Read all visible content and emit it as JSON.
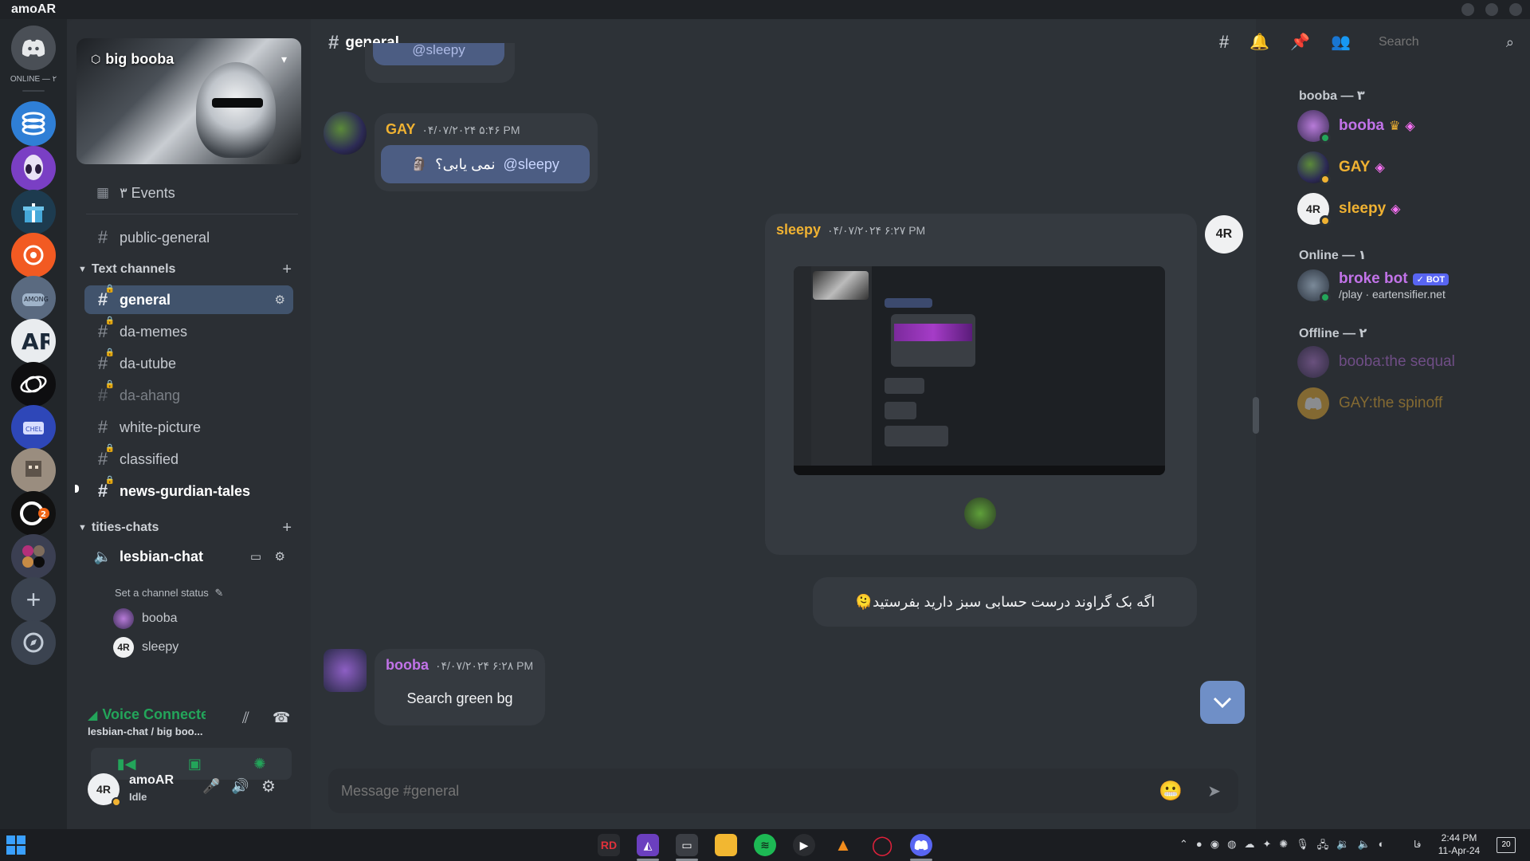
{
  "window": {
    "title": "amoAR"
  },
  "rail": {
    "online_label": "ONLINE — ۲"
  },
  "server": {
    "name": "big booba"
  },
  "sidebar": {
    "events_label": "۳ Events",
    "public_channel": "public-general",
    "text_category": "Text channels",
    "text_channels": [
      "general",
      "da-memes",
      "da-utube",
      "da-ahang",
      "white-picture",
      "classified",
      "news-gurdian-tales"
    ],
    "voice_category": "tities-chats",
    "voice_channel": "lesbian-chat",
    "channel_status": "Set a channel status",
    "voice_users": [
      "booba",
      "sleepy"
    ]
  },
  "voice_panel": {
    "title": "Voice Connected",
    "subtitle": "lesbian-chat / big boo..."
  },
  "user_panel": {
    "name": "amoAR",
    "status": "Idle"
  },
  "chat": {
    "channel": "general",
    "partial_mention": "@sleepy",
    "messages": [
      {
        "author": "GAY",
        "time": "۰۴/۰۷/۲۰۲۴ ۵:۴۶ PM",
        "text": "نمی یابی؟",
        "mention": "@sleepy",
        "color": "#f0b232"
      },
      {
        "author": "sleepy",
        "time": "۰۴/۰۷/۲۰۲۴ ۶:۲۷ PM",
        "text": "",
        "color": "#f0b232"
      },
      {
        "author": "",
        "time": "",
        "text": "اگه بک گراوند درست حسابی سبز دارید بفرستید🫠"
      },
      {
        "author": "booba",
        "time": "۰۴/۰۷/۲۰۲۴ ۶:۲۸ PM",
        "text": "Search green bg",
        "color": "#c273e9"
      }
    ],
    "composer_placeholder": "Message #general"
  },
  "search": {
    "placeholder": "Search"
  },
  "members": {
    "group1_head": "booba — ۳",
    "group1": [
      {
        "name": "booba",
        "color": "#c273e9"
      },
      {
        "name": "GAY",
        "color": "#f0b232"
      },
      {
        "name": "sleepy",
        "color": "#f0b232"
      }
    ],
    "group2_head": "Online — ۱",
    "group2": [
      {
        "name": "broke bot",
        "badge": "✓ BOT",
        "sub": "/play · eartensifier.net",
        "color": "#c273e9"
      }
    ],
    "group3_head": "Offline — ۲",
    "group3": [
      {
        "name": "booba:the sequal",
        "color": "#7d5a93"
      },
      {
        "name": "GAY:the spinoff",
        "color": "#8a6a2a"
      }
    ]
  },
  "taskbar": {
    "time": "2:44 PM",
    "date": "11-Apr-24",
    "lang": "فا",
    "notif_count": "20"
  },
  "colors": {
    "accent": "#5865f2",
    "idle": "#f0b232",
    "online": "#23a55a"
  }
}
